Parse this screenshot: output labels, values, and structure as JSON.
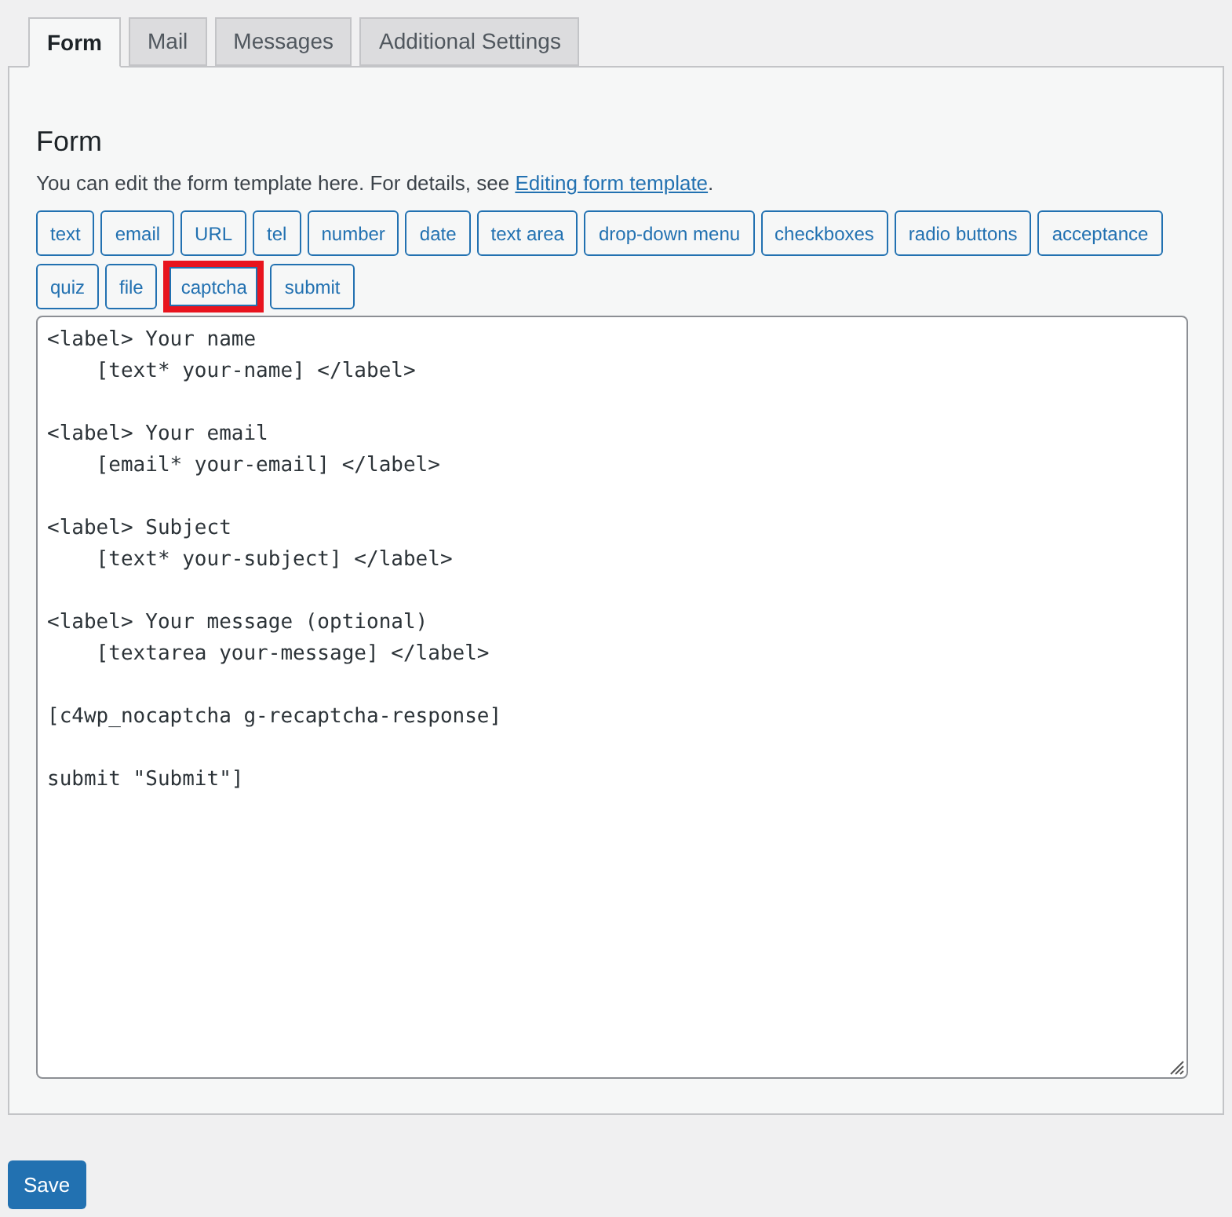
{
  "tabs": [
    {
      "label": "Form",
      "selected": true
    },
    {
      "label": "Mail",
      "selected": false
    },
    {
      "label": "Messages",
      "selected": false
    },
    {
      "label": "Additional Settings",
      "selected": false
    }
  ],
  "panel": {
    "title": "Form",
    "description": "You can edit the form template here. For details, see ",
    "link": "Editing form template",
    "description_end": ".",
    "tag_buttons": [
      {
        "label": "text",
        "highlighted": false
      },
      {
        "label": "email",
        "highlighted": false
      },
      {
        "label": "URL",
        "highlighted": false
      },
      {
        "label": "tel",
        "highlighted": false
      },
      {
        "label": "number",
        "highlighted": false
      },
      {
        "label": "date",
        "highlighted": false
      },
      {
        "label": "text area",
        "highlighted": false
      },
      {
        "label": "drop-down menu",
        "highlighted": false
      },
      {
        "label": "checkboxes",
        "highlighted": false
      },
      {
        "label": "radio buttons",
        "highlighted": false
      },
      {
        "label": "acceptance",
        "highlighted": false
      },
      {
        "label": "quiz",
        "highlighted": false
      },
      {
        "label": "file",
        "highlighted": false
      },
      {
        "label": "captcha",
        "highlighted": true
      },
      {
        "label": "submit",
        "highlighted": false
      }
    ],
    "template": "<label> Your name\n    [text* your-name] </label>\n\n<label> Your email\n    [email* your-email] </label>\n\n<label> Subject\n    [text* your-subject] </label>\n\n<label> Your message (optional)\n    [textarea your-message] </label>\n\n[c4wp_nocaptcha g-recaptcha-response]\n\nsubmit \"Submit\"]"
  },
  "save_button": "Save"
}
